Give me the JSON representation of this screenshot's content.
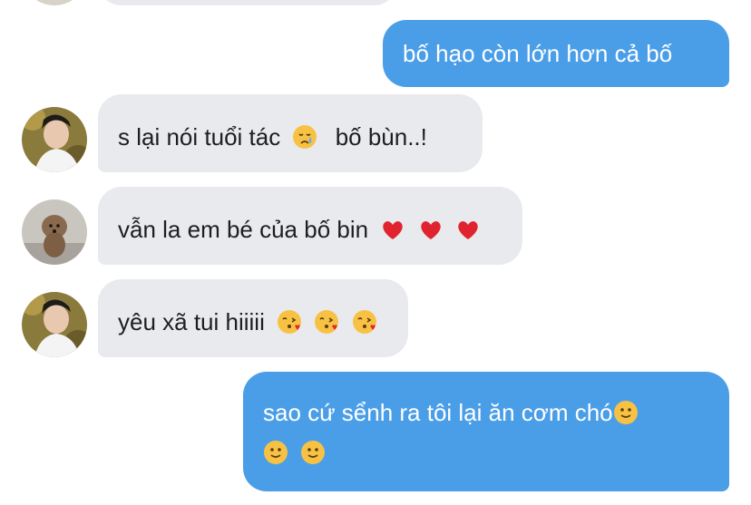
{
  "conversation": {
    "messages": [
      {
        "direction": "outgoing",
        "text": "bố hạo còn lớn hơn cả bố"
      },
      {
        "direction": "incoming",
        "avatar": "person-avatar-icon",
        "text": "s lại nói tuổi tác",
        "emoji": [
          "crying-face-icon"
        ],
        "text_after": "bố bùn..!"
      },
      {
        "direction": "incoming",
        "avatar": "dog-avatar-icon",
        "text": "vẫn la em bé của bố bin",
        "emoji": [
          "red-heart-icon",
          "red-heart-icon",
          "red-heart-icon"
        ]
      },
      {
        "direction": "incoming",
        "avatar": "person-avatar-icon",
        "text": "yêu xã tui hiiiii",
        "emoji": [
          "kissing-face-icon",
          "kissing-face-icon",
          "kissing-face-icon"
        ]
      },
      {
        "direction": "outgoing",
        "text": "sao cứ sểnh ra tôi lại ăn cơm chó",
        "emoji": [
          "slight-smile-icon",
          "slight-smile-icon",
          "slight-smile-icon"
        ]
      }
    ]
  },
  "colors": {
    "outgoing_bubble": "#4a9ee8",
    "incoming_bubble": "#e9eaee",
    "incoming_text": "#1c1e21",
    "outgoing_text": "#ffffff"
  }
}
